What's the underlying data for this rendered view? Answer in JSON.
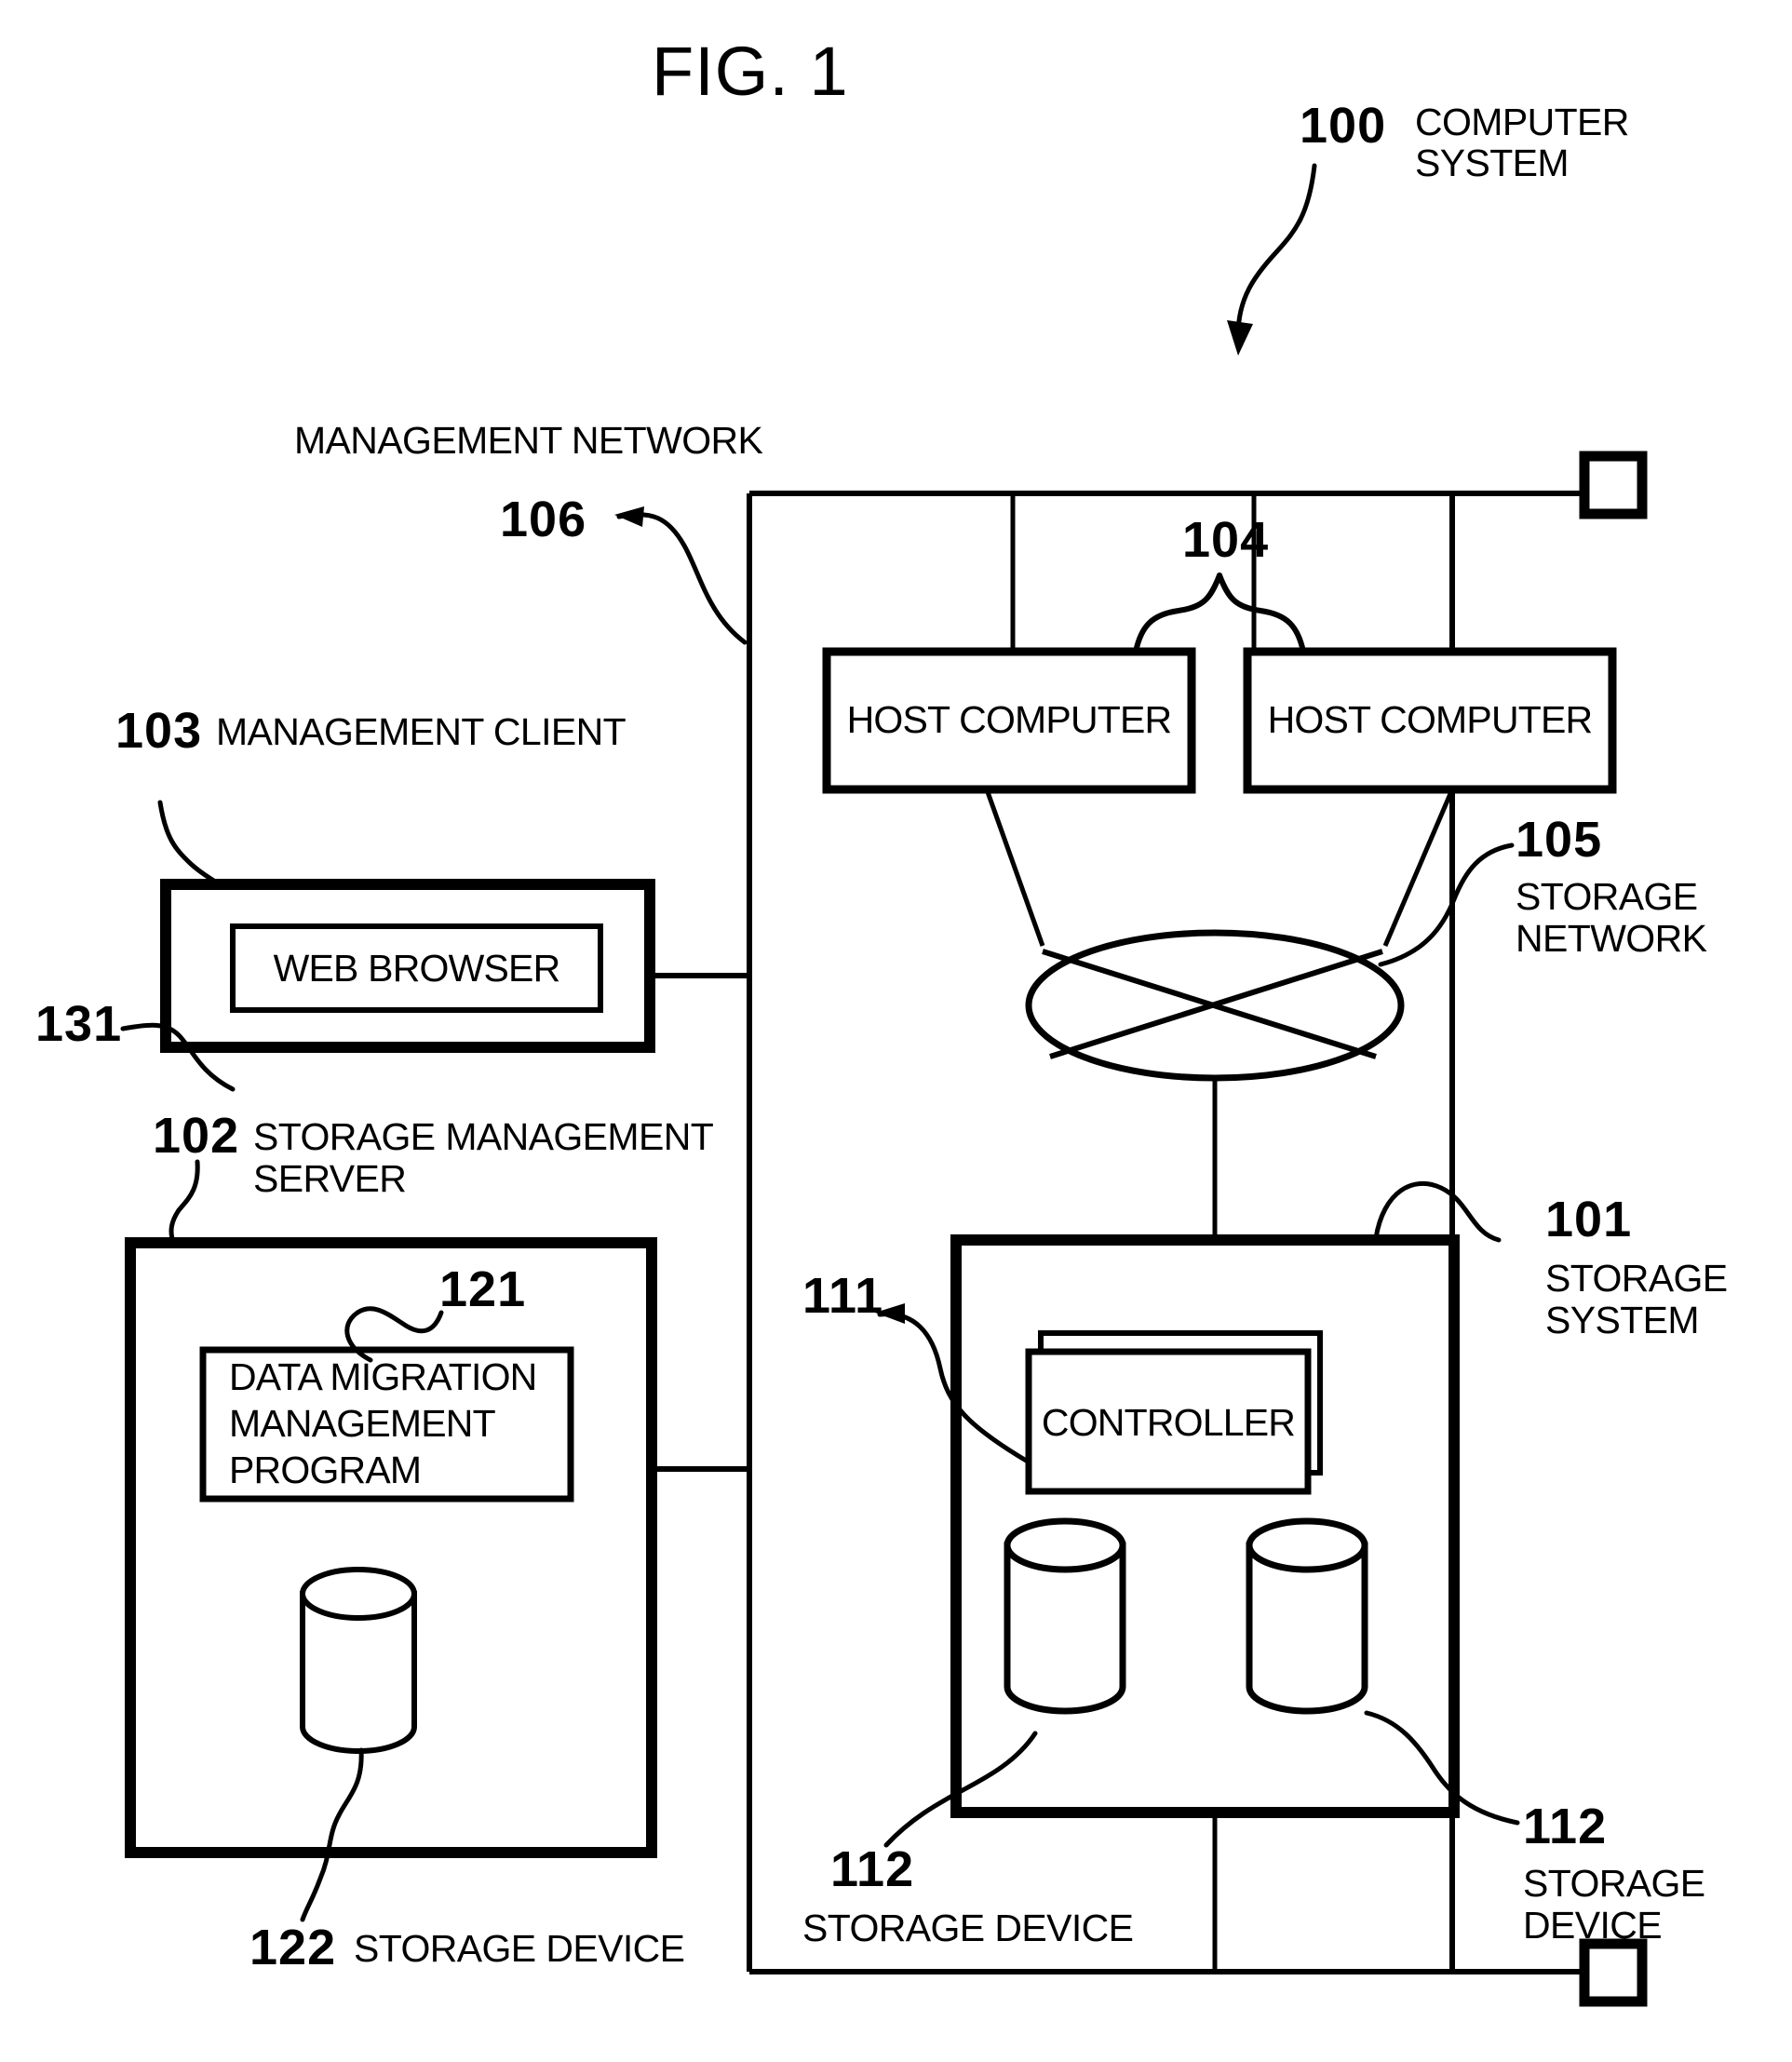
{
  "figure": {
    "title": "FIG. 1"
  },
  "references": {
    "computer_system": {
      "number": "100",
      "label_line1": "COMPUTER",
      "label_line2": "SYSTEM"
    },
    "storage_system": {
      "number": "101",
      "label_line1": "STORAGE",
      "label_line2": "SYSTEM"
    },
    "storage_management_server": {
      "number": "102",
      "label_line1": "STORAGE MANAGEMENT",
      "label_line2": "SERVER"
    },
    "management_client": {
      "number": "103",
      "label": "MANAGEMENT CLIENT"
    },
    "host_computers": {
      "number": "104"
    },
    "storage_network": {
      "number": "105",
      "label_line1": "STORAGE",
      "label_line2": "NETWORK"
    },
    "management_network": {
      "number": "106",
      "label": "MANAGEMENT NETWORK"
    },
    "controller": {
      "number": "111"
    },
    "storage_device_right": {
      "number": "112",
      "label_line1": "STORAGE",
      "label_line2": "DEVICE"
    },
    "storage_device_bottom": {
      "number": "112",
      "label": "STORAGE DEVICE"
    },
    "data_migration_program": {
      "number": "121"
    },
    "server_storage_device": {
      "number": "122",
      "label": "STORAGE DEVICE"
    },
    "web_browser": {
      "number": "131"
    }
  },
  "boxes": {
    "web_browser": "WEB BROWSER",
    "data_migration_program_line1": "DATA MIGRATION",
    "data_migration_program_line2": "MANAGEMENT",
    "data_migration_program_line3": "PROGRAM",
    "host_computer_left": "HOST COMPUTER",
    "host_computer_right": "HOST COMPUTER",
    "controller": "CONTROLLER"
  },
  "colors": {
    "ink": "#000000",
    "paper": "#ffffff"
  }
}
